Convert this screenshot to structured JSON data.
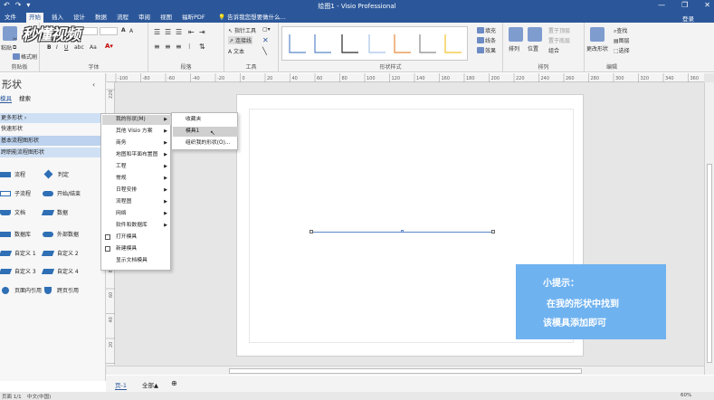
{
  "window": {
    "title": "绘图1 - Visio Professional",
    "qat": [
      "↶",
      "↷",
      "▾"
    ],
    "controls": [
      "—",
      "❐",
      "✕"
    ]
  },
  "tabs": [
    {
      "label": "文件",
      "active": false
    },
    {
      "label": "开始",
      "active": true
    },
    {
      "label": "插入",
      "active": false
    },
    {
      "label": "设计",
      "active": false
    },
    {
      "label": "数据",
      "active": false
    },
    {
      "label": "流程",
      "active": false
    },
    {
      "label": "审阅",
      "active": false
    },
    {
      "label": "视图",
      "active": false
    },
    {
      "label": "福昕PDF",
      "active": false
    }
  ],
  "tellme": "告诉我您想要做什么...",
  "login": "登录",
  "ribbon": {
    "clipboard": {
      "label": "剪贴板",
      "paste": "粘贴",
      "format_painter": "格式刷"
    },
    "font": {
      "label": "字体"
    },
    "paragraph": {
      "label": "段落"
    },
    "tools": {
      "label": "工具",
      "pointer": "指针工具",
      "connector": "连接线",
      "text": "文本"
    },
    "shape_styles": {
      "label": "形状样式"
    },
    "shape_buttons": [
      "填充",
      "线条",
      "效果"
    ],
    "arrange": {
      "label": "排列",
      "align": "排列",
      "position": "位置",
      "bring_front": "置于顶层",
      "send_back": "置于底层",
      "group": "组合"
    },
    "edit": {
      "label": "编辑",
      "change_shape": "更改形状",
      "find": "查找",
      "layers": "图层",
      "select": "选择"
    }
  },
  "panel": {
    "title": "形状",
    "collapse": "‹",
    "tab_stencils": "模具",
    "tab_search": "搜索",
    "rows": [
      {
        "label": "更多形状  ›",
        "style": "hl"
      },
      {
        "label": "快速形状",
        "style": ""
      },
      {
        "label": "基本流程图形状",
        "style": "hl2"
      },
      {
        "label": "跨职能流程图形状",
        "style": "hl"
      }
    ],
    "shapes": [
      {
        "label": "流程",
        "kind": "rect"
      },
      {
        "label": "判定",
        "kind": "diamond"
      },
      {
        "label": "子流程",
        "kind": "rect-outline"
      },
      {
        "label": "开始/结束",
        "kind": "round"
      },
      {
        "label": "文档",
        "kind": "doc"
      },
      {
        "label": "数据",
        "kind": "para"
      },
      {
        "label": "数据库",
        "kind": "rect"
      },
      {
        "label": "外部数据",
        "kind": "round"
      },
      {
        "label": "自定义 1",
        "kind": "para"
      },
      {
        "label": "自定义 2",
        "kind": "para"
      },
      {
        "label": "自定义 3",
        "kind": "para"
      },
      {
        "label": "自定义 4",
        "kind": "para"
      },
      {
        "label": "页面内引用",
        "kind": "circle"
      },
      {
        "label": "跨页引用",
        "kind": "shield"
      }
    ]
  },
  "menu1": [
    {
      "label": "我的形状(M)",
      "arrow": true,
      "selected": true,
      "icon": false
    },
    {
      "label": "其他 Visio 方案",
      "arrow": true,
      "selected": false,
      "icon": false
    },
    {
      "label": "商务",
      "arrow": true,
      "selected": false,
      "icon": false
    },
    {
      "label": "地图和平面布置图",
      "arrow": true,
      "selected": false,
      "icon": false
    },
    {
      "label": "工程",
      "arrow": true,
      "selected": false,
      "icon": false
    },
    {
      "label": "常规",
      "arrow": true,
      "selected": false,
      "icon": false
    },
    {
      "label": "日程安排",
      "arrow": true,
      "selected": false,
      "icon": false
    },
    {
      "label": "流程图",
      "arrow": true,
      "selected": false,
      "icon": false
    },
    {
      "label": "网络",
      "arrow": true,
      "selected": false,
      "icon": false
    },
    {
      "label": "软件和数据库",
      "arrow": true,
      "selected": false,
      "icon": false
    },
    {
      "label": "打开模具",
      "arrow": false,
      "selected": false,
      "icon": true
    },
    {
      "label": "新建模具",
      "arrow": false,
      "selected": false,
      "icon": true
    },
    {
      "label": "显示文档模具",
      "arrow": false,
      "selected": false,
      "icon": false
    }
  ],
  "menu2": [
    {
      "label": "收藏夹",
      "selected": false
    },
    {
      "label": "模具1",
      "selected": true
    },
    {
      "label": "组织我的形状(O)...",
      "selected": false
    }
  ],
  "ruler_h": [
    "-100",
    "-80",
    "-60",
    "-40",
    "-20",
    "0",
    "20",
    "40",
    "60",
    "80",
    "100",
    "120",
    "140",
    "160",
    "180",
    "200",
    "220",
    "240",
    "260",
    "280",
    "300",
    "320",
    "340",
    "360"
  ],
  "ruler_v": [
    "220",
    "200",
    "180",
    "160",
    "140",
    "120",
    "100",
    "80",
    "60",
    "40",
    "20",
    "0"
  ],
  "tip": {
    "l1": "小提示：",
    "l2": "在我的形状中找到",
    "l3": "该模具添加即可"
  },
  "logo": "秒懂视频",
  "pagetabs": {
    "page": "页-1",
    "all": "全部▲",
    "add": "⊕"
  },
  "status": {
    "page": "页面 1/1",
    "lang": "中文(中国)",
    "zoom": "60%"
  }
}
